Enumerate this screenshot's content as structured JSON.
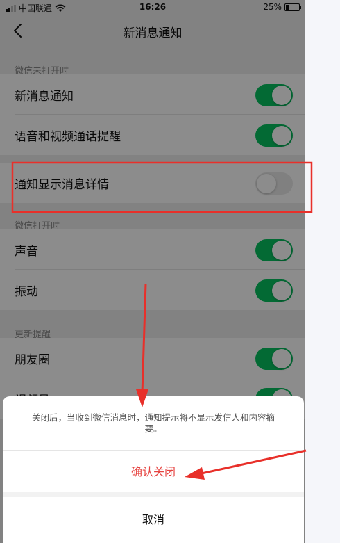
{
  "status_bar": {
    "carrier": "中国联通",
    "time": "16:26",
    "battery": "25%",
    "battery_level": 0.25
  },
  "nav": {
    "title": "新消息通知"
  },
  "sections": {
    "closed": {
      "header": "微信未打开时"
    },
    "open": {
      "header": "微信打开时"
    },
    "updates": {
      "header": "更新提醒"
    }
  },
  "rows": {
    "new_message": {
      "label": "新消息通知",
      "enabled": true
    },
    "call_reminder": {
      "label": "语音和视频通话提醒",
      "enabled": true
    },
    "show_details": {
      "label": "通知显示消息详情",
      "enabled": false
    },
    "sound": {
      "label": "声音",
      "enabled": true
    },
    "vibrate": {
      "label": "振动",
      "enabled": true
    },
    "moments": {
      "label": "朋友圈",
      "enabled": true
    },
    "channels": {
      "label": "视频号",
      "enabled": true
    }
  },
  "sheet": {
    "message": "关闭后，当收到微信消息时，通知提示将不显示发信人和内容摘要。",
    "confirm": "确认关闭",
    "cancel": "取消"
  },
  "colors": {
    "toggle_on": "#07c160",
    "toggle_off": "#e9e9e9",
    "danger": "#e64340",
    "annotation": "#e8302a"
  }
}
